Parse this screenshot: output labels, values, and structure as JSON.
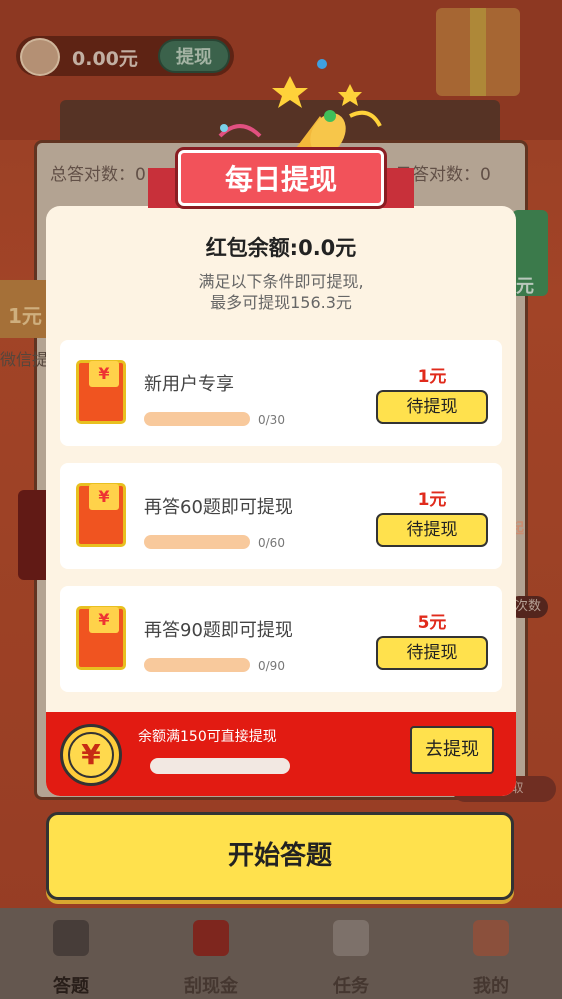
{
  "header": {
    "coin_amount": "0.00元",
    "withdraw_label": "提现"
  },
  "background": {
    "total_correct_left": "总答对数：0",
    "today_correct_right": "日答对数：0",
    "side_left_amount": "1元",
    "side_left_wechat": "微信提",
    "side_right_amount": "元",
    "right_badge": "起",
    "right_badge2": "次数",
    "right_pill": "可领取"
  },
  "modal": {
    "ribbon_title": "每日提现",
    "balance": "红包余额:0.0元",
    "condition_line1": "满足以下条件即可提现,",
    "condition_line2": "最多可提现156.3元",
    "tasks": [
      {
        "title": "新用户专享",
        "progress_text": "0/30",
        "progress": 0,
        "reward": "1元",
        "button": "待提现"
      },
      {
        "title": "再答60题即可提现",
        "progress_text": "0/60",
        "progress": 0,
        "reward": "1元",
        "button": "待提现"
      },
      {
        "title": "再答90题即可提现",
        "progress_text": "0/90",
        "progress": 0,
        "reward": "5元",
        "button": "待提现"
      }
    ],
    "yen_symbol": "¥",
    "envelope_symbol": "¥",
    "direct_withdraw_text": "余额满150可直接提现",
    "direct_withdraw_button": "去提现"
  },
  "start_button": "开始答题",
  "tabs": [
    {
      "label": "答题",
      "icon": "quiz-icon"
    },
    {
      "label": "刮现金",
      "icon": "scratch-card-icon"
    },
    {
      "label": "任务",
      "icon": "task-clipboard-icon"
    },
    {
      "label": "我的",
      "icon": "shop-profile-icon"
    }
  ],
  "colors": {
    "accent_yellow": "#ffe14d",
    "red": "#e21b12",
    "ribbon": "#f2525a",
    "reward_red": "#e02b1c"
  }
}
